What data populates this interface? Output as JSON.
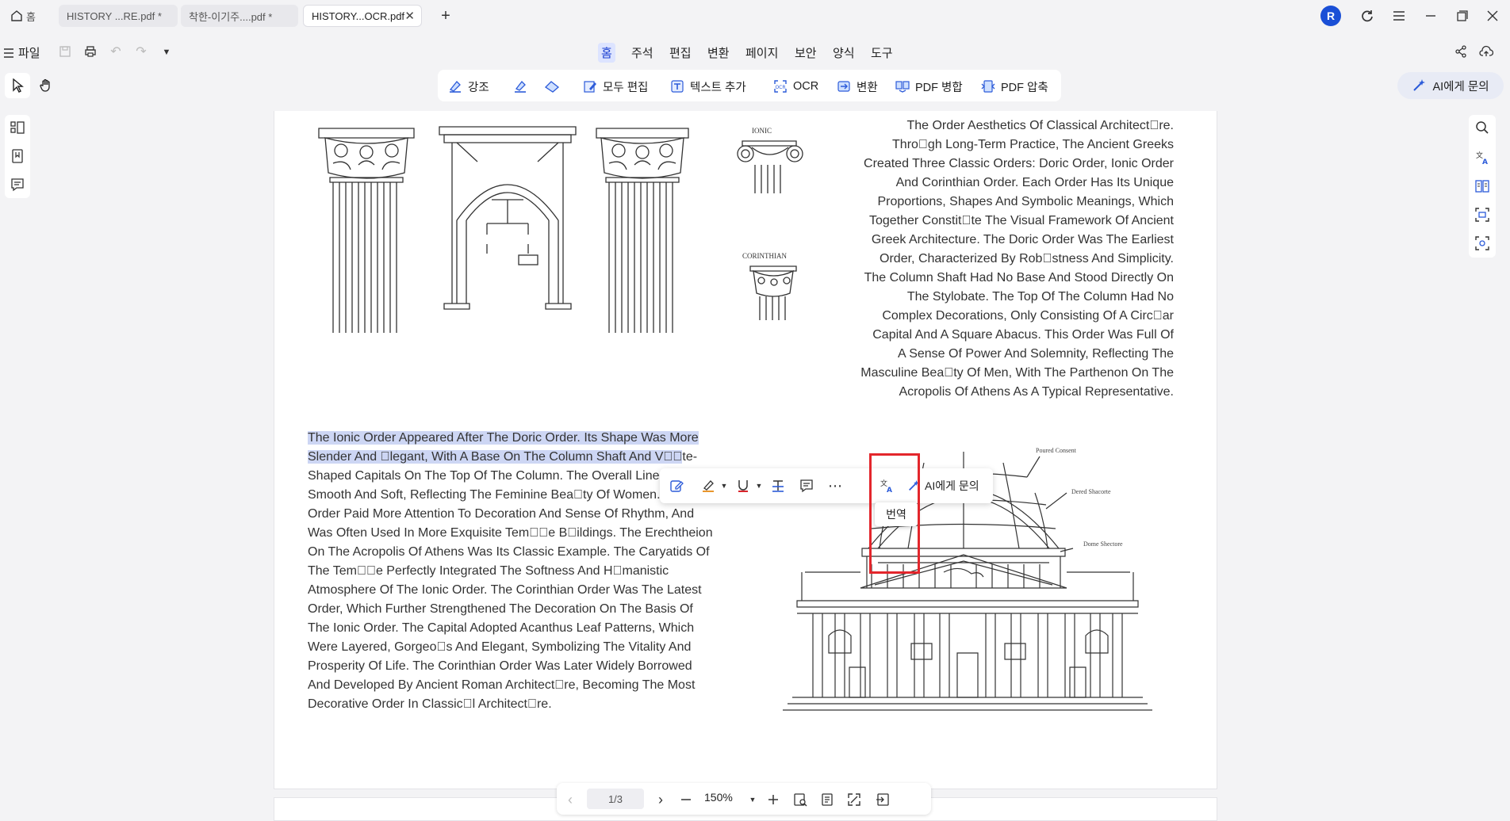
{
  "titlebar": {
    "home_label": "홈",
    "tabs": [
      {
        "label": "HISTORY ...RE.pdf *"
      },
      {
        "label": "착한-이기주....pdf *"
      },
      {
        "label": "HISTORY...OCR.pdf"
      }
    ],
    "avatar_letter": "R"
  },
  "menubar": {
    "file_label": "파일",
    "items": [
      "홈",
      "주석",
      "편집",
      "변환",
      "페이지",
      "보안",
      "양식",
      "도구"
    ]
  },
  "ribbon": {
    "items": [
      "강조",
      "모두 편집",
      "텍스트 추가",
      "OCR",
      "변환",
      "PDF 병합",
      "PDF 압축"
    ]
  },
  "ai_button": {
    "label": "AI에게 문의"
  },
  "document": {
    "fig_labels": {
      "ionic": "IONIC",
      "corinthian": "CORINTHIAN"
    },
    "dome_labels": [
      "Poured Consent",
      "Dered Shacorte",
      "Dome Shectore"
    ],
    "right_paragraph": [
      "The Order Aesthetics Of Classical Architect\u0000re.",
      "Thro\u0000gh Long-Term Practice, The Ancient Greeks",
      "Created Three Classic Orders: Doric Order, Ionic Order",
      "And Corinthian Order. Each Order Has Its Unique",
      "Proportions, Shapes And Symbolic Meanings, Which",
      "Together Constit\u0000te The Visual Framework Of Ancient",
      "Greek Architecture. The Doric Order Was The Earliest",
      "Order, Characterized By Rob\u0000stness And Simplicity.",
      "The Column Shaft Had No Base And Stood Directly On",
      "The Stylobate. The Top Of The Column Had No",
      "Complex Decorations, Only Consisting Of A Circ\u0000ar",
      "Capital And A Square Abacus. This Order Was Full Of",
      "A Sense Of Power And Solemnity, Reflecting The",
      "Masculine Bea\u0000ty Of Men, With The Parthenon On The",
      "Acropolis Of Athens As A Typical Representative."
    ],
    "left_highlight_1": "The Ionic Order Appeared After The Doric Order. Its Shape Was More",
    "left_highlight_2": "Slender And \u0000legant, With A Base On The Column Shaft And V\u0000\u0000",
    "left_line2_tail": "te-",
    "left_paragraph_rest": [
      "Shaped Capitals On The Top Of The Column. The Overall Line",
      "Smooth And Soft, Reflecting The Feminine Bea\u0000ty Of Women.",
      "Order Paid More Attention To Decoration And Sense Of Rhythm, And",
      "Was Often Used In More Exquisite Tem\u0000\u0000e B\u0000ildings. The Erechtheion",
      "On The Acropolis Of Athens Was Its Classic Example. The Caryatids Of",
      "The Tem\u0000\u0000e Perfectly Integrated The Softness And H\u0000manistic",
      "Atmosphere Of The Ionic Order. The Corinthian Order Was The Latest",
      "Order, Which Further Strengthened The Decoration On The Basis Of",
      "The Ionic Order. The Capital Adopted Acanthus Leaf Patterns, Which",
      "Were Layered, Gorgeo\u0000s And Elegant, Symbolizing The Vitality And",
      "Prosperity Of Life. The Corinthian Order Was Later Widely Borrowed",
      "And Developed By Ancient Roman Architect\u0000re, Becoming The Most",
      "Decorative Order In Classic\u0000l Architect\u0000re."
    ]
  },
  "floatbar": {
    "ai_label": "AI에게 문의",
    "tooltip": "번역"
  },
  "bottombar": {
    "page_indicator": "1/3",
    "zoom": "150%"
  }
}
